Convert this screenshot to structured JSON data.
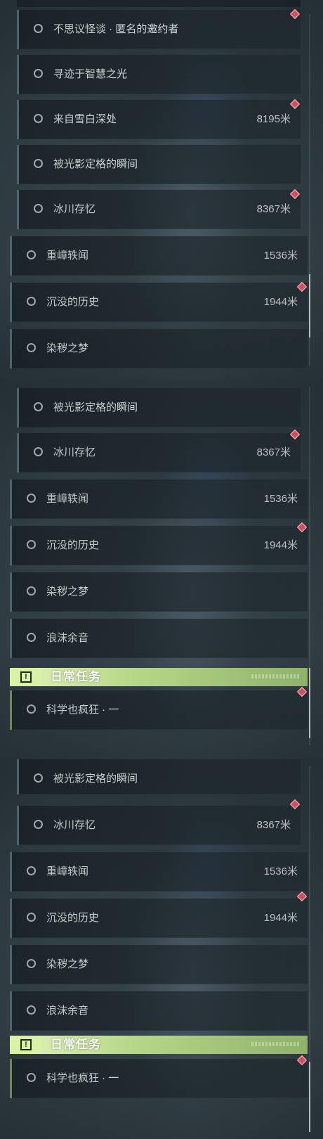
{
  "panels": [
    {
      "rows": [
        {
          "label": "不思议怪谈 · 匿名的邀约者",
          "distance": ""
        },
        {
          "label": "寻迹于智慧之光",
          "distance": ""
        },
        {
          "label": "来自雪白深处",
          "distance": "8195米"
        },
        {
          "label": "被光影定格的瞬间",
          "distance": ""
        },
        {
          "label": "冰川存忆",
          "distance": "8367米"
        },
        {
          "label": "重嶂轶闻",
          "distance": "1536米"
        },
        {
          "label": "沉没的历史",
          "distance": "1944米"
        },
        {
          "label": "染秽之梦",
          "distance": ""
        }
      ]
    },
    {
      "rows": [
        {
          "label": "被光影定格的瞬间",
          "distance": ""
        },
        {
          "label": "冰川存忆",
          "distance": "8367米"
        },
        {
          "label": "重嶂轶闻",
          "distance": "1536米"
        },
        {
          "label": "沉没的历史",
          "distance": "1944米"
        },
        {
          "label": "染秽之梦",
          "distance": ""
        },
        {
          "label": "浪沫余音",
          "distance": ""
        }
      ],
      "section": {
        "title": "日常任务",
        "icon": "exclamation-icon"
      },
      "daily_rows": [
        {
          "label": "科学也疯狂 · 一",
          "distance": ""
        }
      ]
    },
    {
      "rows": [
        {
          "label": "被光影定格的瞬间",
          "distance": ""
        },
        {
          "label": "冰川存忆",
          "distance": "8367米"
        },
        {
          "label": "重嶂轶闻",
          "distance": "1536米"
        },
        {
          "label": "沉没的历史",
          "distance": "1944米"
        },
        {
          "label": "染秽之梦",
          "distance": ""
        },
        {
          "label": "浪沫余音",
          "distance": ""
        }
      ],
      "section": {
        "title": "日常任务",
        "icon": "exclamation-icon"
      },
      "daily_rows": [
        {
          "label": "科学也疯狂 · 一",
          "distance": ""
        }
      ]
    }
  ],
  "colors": {
    "marker": "#d94a5c",
    "daily_header": "#b8d889",
    "row_bar": "#5f7a84"
  }
}
